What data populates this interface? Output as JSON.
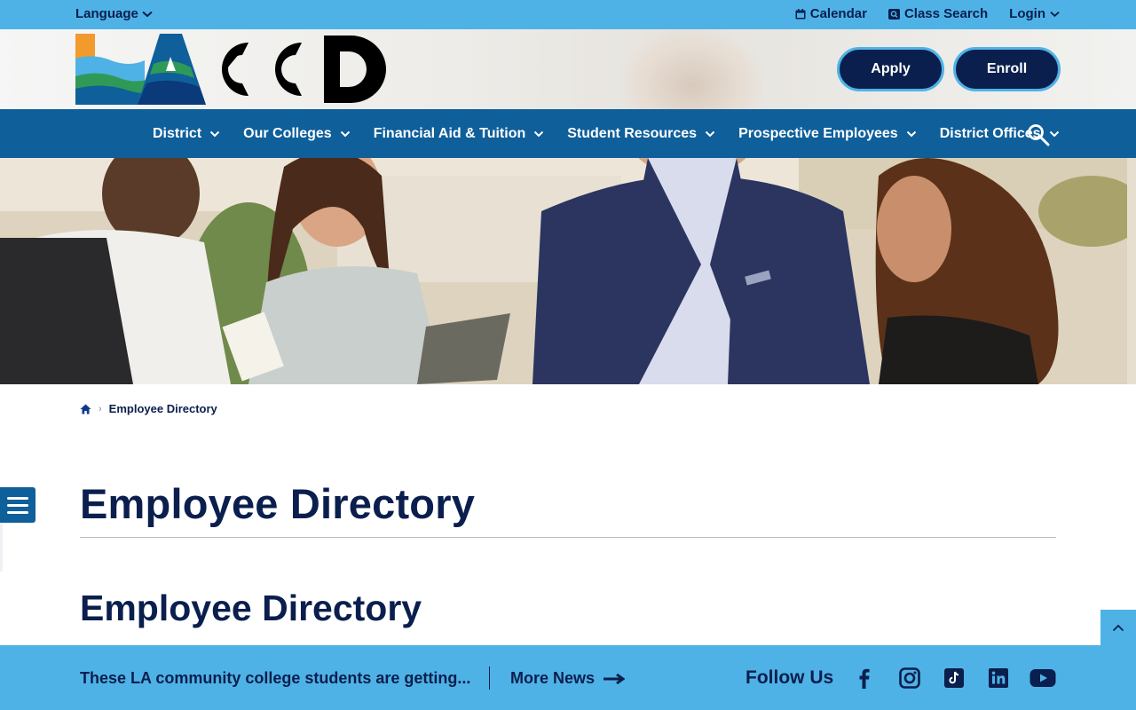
{
  "utility": {
    "language": "Language",
    "calendar": "Calendar",
    "class_search": "Class Search",
    "login": "Login"
  },
  "header": {
    "logo_text": "LACCD",
    "apply": "Apply",
    "enroll": "Enroll"
  },
  "nav": {
    "items": [
      "District",
      "Our Colleges",
      "Financial Aid & Tuition",
      "Student Resources",
      "Prospective Employees",
      "District Offices"
    ]
  },
  "breadcrumb": {
    "current": "Employee Directory"
  },
  "main": {
    "title": "Employee Directory",
    "subtitle": "Employee Directory"
  },
  "footer": {
    "news_headline": "These LA community college students are getting...",
    "more_news": "More News",
    "follow_us": "Follow Us",
    "social_icons": [
      "facebook-icon",
      "instagram-icon",
      "tiktok-icon",
      "linkedin-icon",
      "youtube-icon"
    ]
  },
  "colors": {
    "navy": "#0a1f4d",
    "sky": "#4fb2e6",
    "nav_blue": "#0f5f9b"
  }
}
